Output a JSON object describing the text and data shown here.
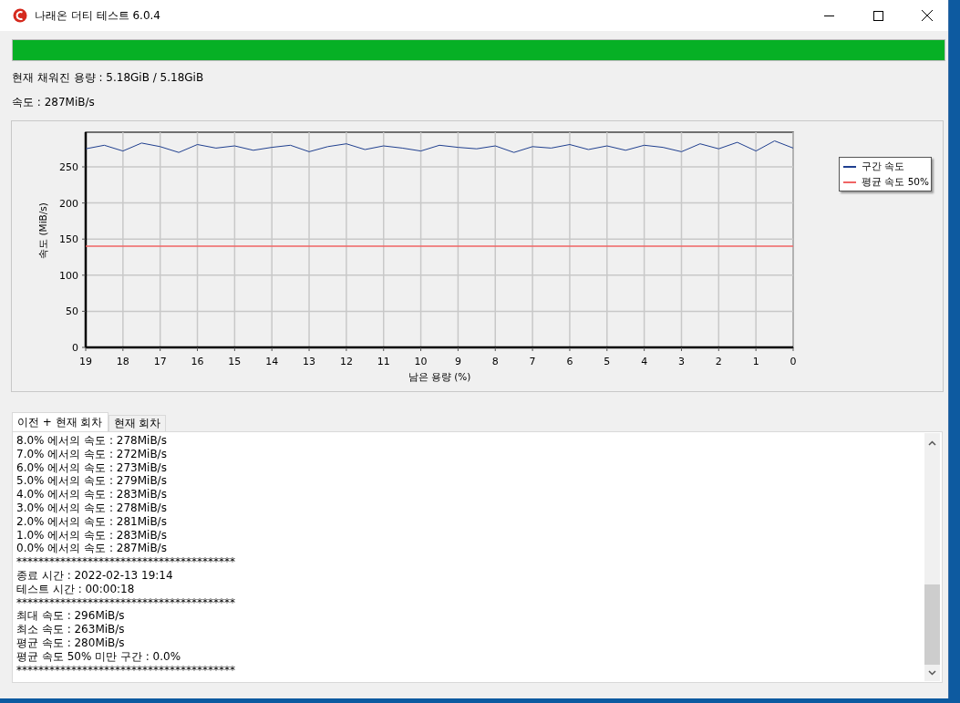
{
  "window": {
    "title": "나래온 더티 테스트 6.0.4"
  },
  "progress": {
    "level": 1.0
  },
  "filled_text": "현재 채워진 용량 : 5.18GiB / 5.18GiB",
  "speed_text": "속도 : 287MiB/s",
  "chart": {
    "chart_data": {
      "type": "line",
      "grid": true,
      "xlabel": "남은 용량 (%)",
      "ylabel": "속도 (MiB/s)",
      "xlim": [
        19,
        0
      ],
      "ylim": [
        0,
        298
      ],
      "xticks": [
        19,
        18,
        17,
        16,
        15,
        14,
        13,
        12,
        11,
        10,
        9,
        8,
        7,
        6,
        5,
        4,
        3,
        2,
        1,
        0
      ],
      "yticks": [
        0,
        50,
        100,
        150,
        200,
        250
      ],
      "x": [
        19,
        18.5,
        18,
        17.5,
        17,
        16.5,
        16,
        15.5,
        15,
        14.5,
        14,
        13.5,
        13,
        12.5,
        12,
        11.5,
        11,
        10.5,
        10,
        9.5,
        9,
        8.5,
        8,
        7.5,
        7,
        6.5,
        6,
        5.5,
        5,
        4.5,
        4,
        3.5,
        3,
        2.5,
        2,
        1.5,
        1,
        0.5,
        0
      ],
      "series": [
        {
          "name": "구간 속도",
          "color": "#1f3f8f",
          "values": [
            275,
            280,
            272,
            283,
            278,
            270,
            281,
            276,
            279,
            273,
            277,
            280,
            271,
            278,
            282,
            274,
            279,
            276,
            272,
            280,
            277,
            275,
            279,
            270,
            278,
            276,
            281,
            274,
            279,
            273,
            280,
            277,
            271,
            282,
            275,
            284,
            272,
            286,
            276
          ]
        },
        {
          "name": "평균 속도 50%",
          "color": "#f06464",
          "values": [
            140,
            140,
            140,
            140,
            140,
            140,
            140,
            140,
            140,
            140,
            140,
            140,
            140,
            140,
            140,
            140,
            140,
            140,
            140,
            140,
            140,
            140,
            140,
            140,
            140,
            140,
            140,
            140,
            140,
            140,
            140,
            140,
            140,
            140,
            140,
            140,
            140,
            140,
            140
          ]
        }
      ]
    }
  },
  "tabs": [
    {
      "label": "이전 + 현재 회차",
      "selected": true
    },
    {
      "label": "현재 회차",
      "selected": false
    }
  ],
  "log": [
    "8.0% 에서의 속도 : 278MiB/s",
    "7.0% 에서의 속도 : 272MiB/s",
    "6.0% 에서의 속도 : 273MiB/s",
    "5.0% 에서의 속도 : 279MiB/s",
    "4.0% 에서의 속도 : 283MiB/s",
    "3.0% 에서의 속도 : 278MiB/s",
    "2.0% 에서의 속도 : 281MiB/s",
    "1.0% 에서의 속도 : 283MiB/s",
    "0.0% 에서의 속도 : 287MiB/s",
    "****************************************",
    "종료 시간 : 2022-02-13 19:14",
    "테스트 시간 : 00:00:18",
    "****************************************",
    "최대 속도 : 296MiB/s",
    "최소 속도 : 263MiB/s",
    "평균 속도 : 280MiB/s",
    "평균 속도 50% 미만 구간 : 0.0%",
    "****************************************"
  ]
}
